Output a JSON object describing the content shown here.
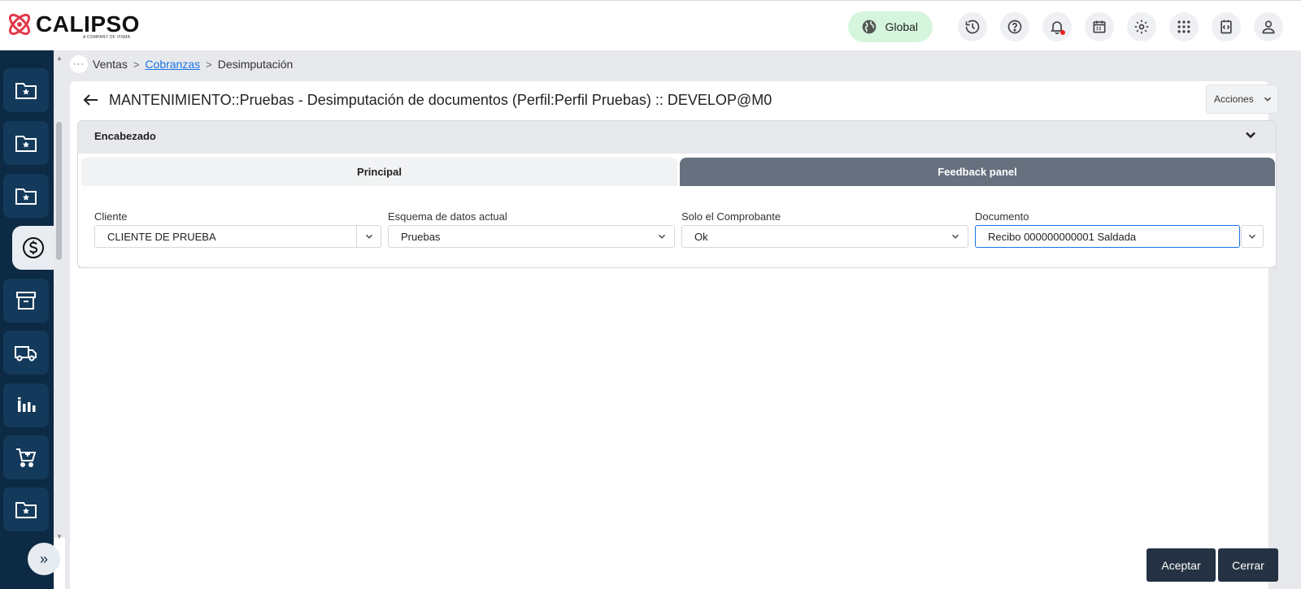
{
  "app": {
    "logo_text": "CALIPSO",
    "logo_subtext": "A COMPANY OF VISMA"
  },
  "topbar": {
    "global_label": "Global",
    "icons": [
      "history-icon",
      "help-icon",
      "bell-icon",
      "calendar-icon",
      "gear-icon",
      "apps-grid-icon",
      "code-box-icon",
      "user-icon"
    ]
  },
  "sidebar": {
    "items": [
      {
        "icon": "folder-star-icon"
      },
      {
        "icon": "folder-star-icon"
      },
      {
        "icon": "folder-star-icon"
      },
      {
        "icon": "dollar-circle-icon",
        "active": true
      },
      {
        "icon": "archive-icon"
      },
      {
        "icon": "truck-icon"
      },
      {
        "icon": "bar-chart-icon"
      },
      {
        "icon": "cart-icon"
      },
      {
        "icon": "folder-star-icon"
      }
    ],
    "expand_label": "»"
  },
  "breadcrumb": {
    "more": "···",
    "items": [
      "Ventas",
      "Cobranzas",
      "Desimputación"
    ]
  },
  "page": {
    "title": "MANTENIMIENTO::Pruebas - Desimputación de documentos (Perfil:Perfil Pruebas) :: DEVELOP@M0",
    "actions_label": "Acciones"
  },
  "section": {
    "title": "Encabezado",
    "tabs": [
      "Principal",
      "Feedback panel"
    ]
  },
  "fields": {
    "cliente": {
      "label": "Cliente",
      "value": "CLIENTE DE PRUEBA"
    },
    "esquema": {
      "label": "Esquema de datos actual",
      "value": "Pruebas"
    },
    "solo": {
      "label": "Solo el Comprobante",
      "value": "Ok"
    },
    "documento": {
      "label": "Documento",
      "value": "Recibo 000000000001  Saldada"
    }
  },
  "footer": {
    "accept_label": "Aceptar",
    "close_label": "Cerrar"
  },
  "colors": {
    "sidebar": "#0d2a44",
    "global_pill": "#d6f5dd",
    "tab_active": "#67707f",
    "button": "#253244",
    "link": "#1a73e8"
  }
}
